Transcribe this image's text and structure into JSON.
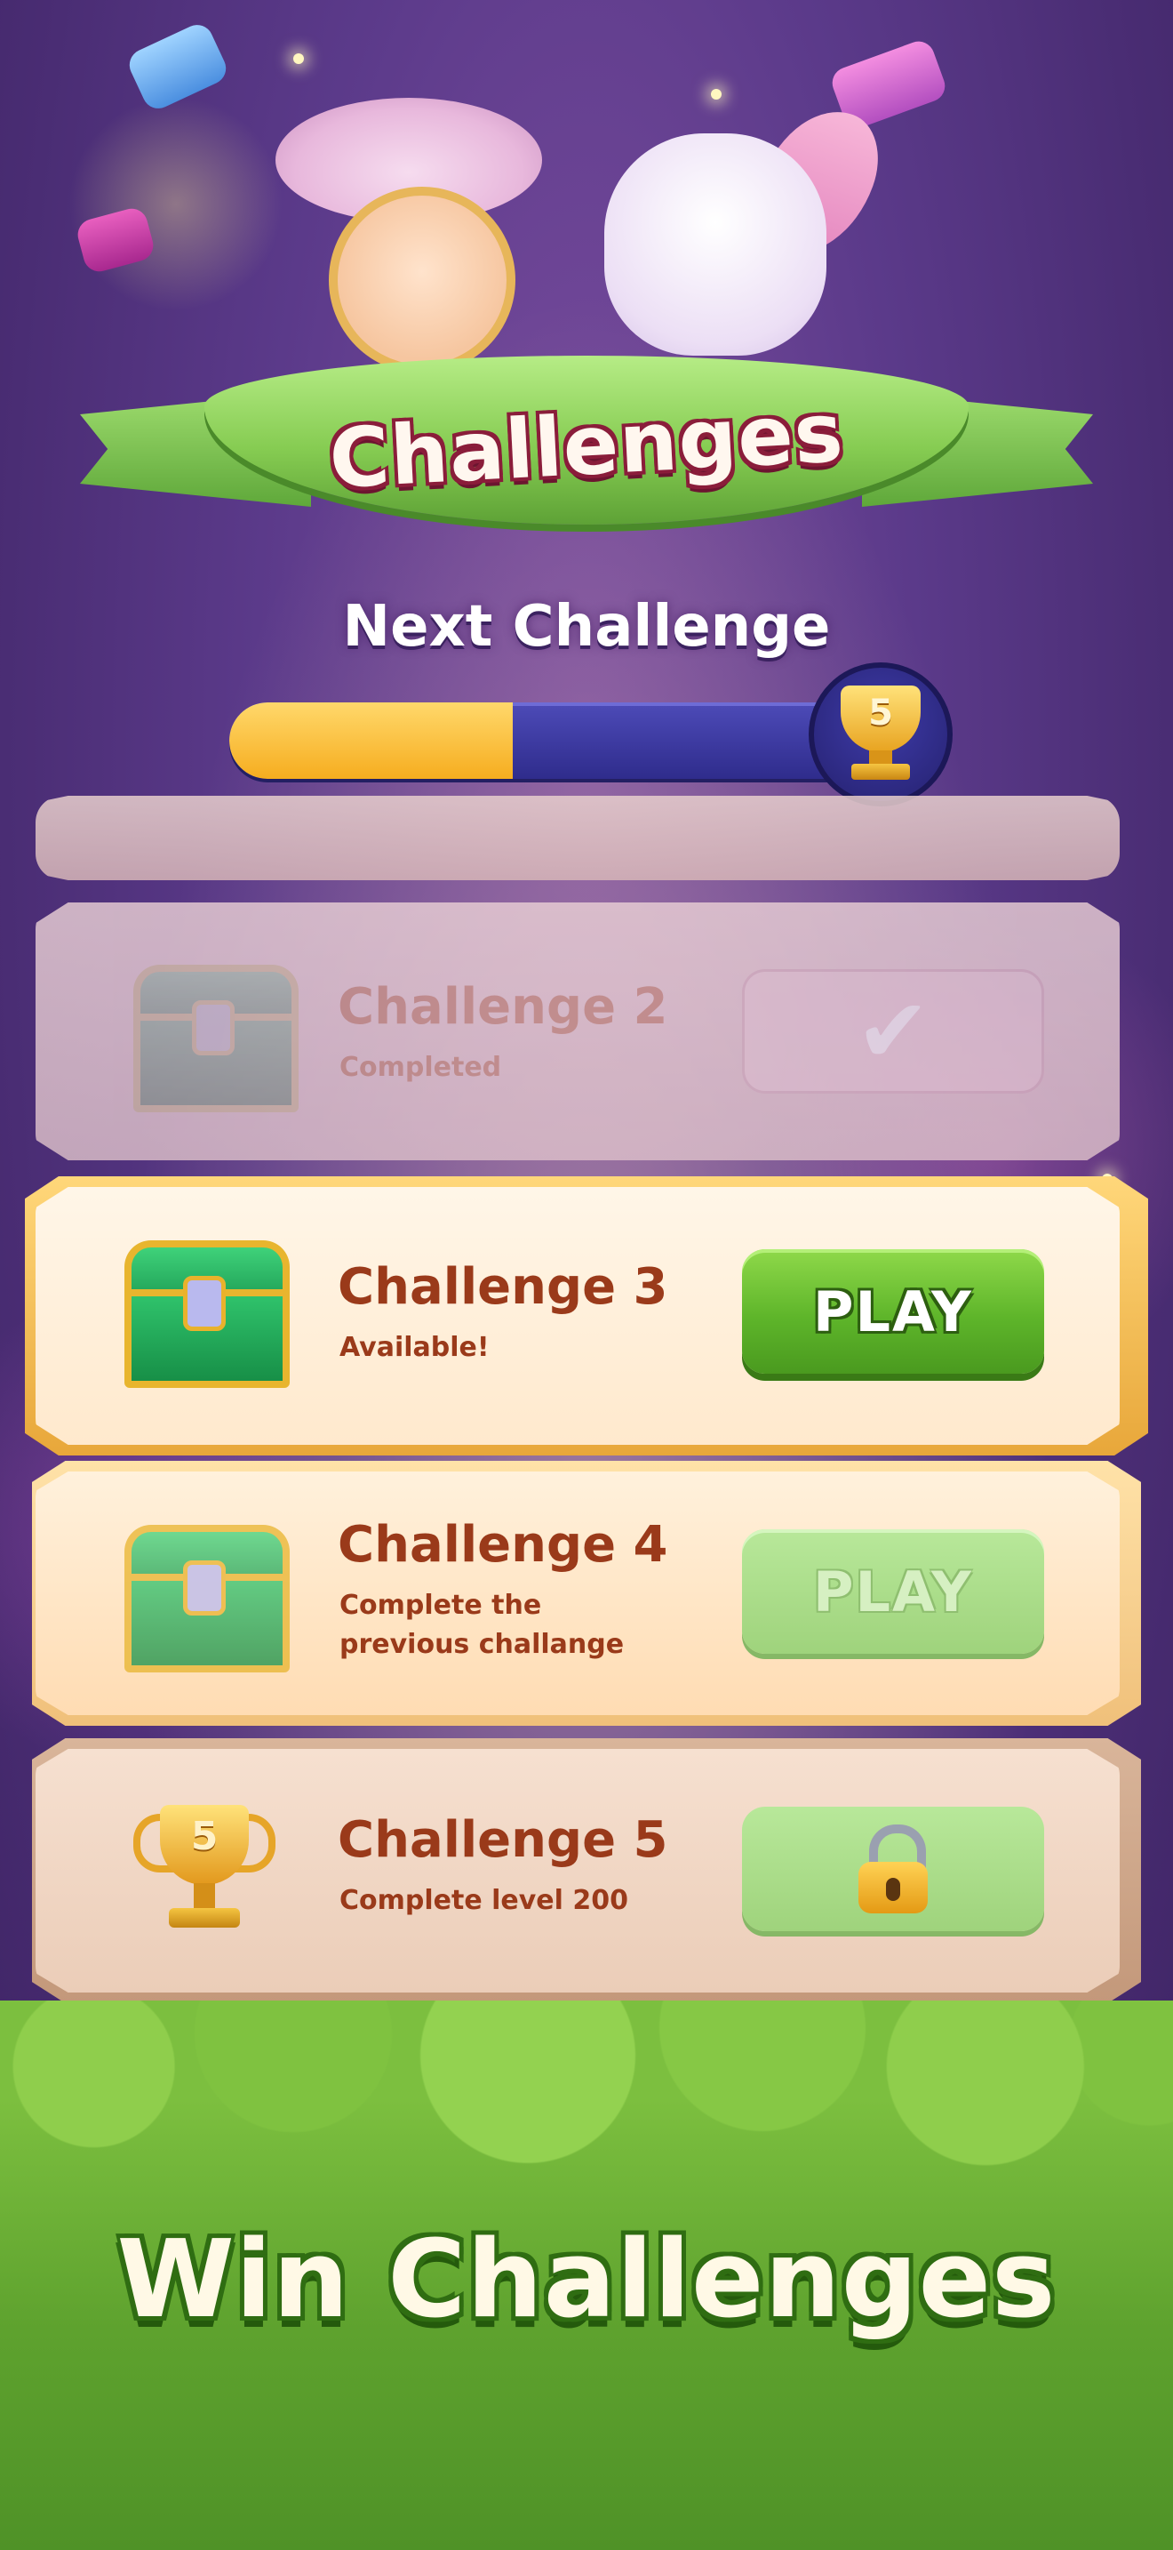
{
  "header": {
    "banner_title": "Challenges",
    "next_challenge_label": "Next Challenge",
    "progress_fraction": 0.42,
    "trophy_number": "5"
  },
  "challenges": [
    {
      "title": "Challenge 2",
      "subtitle": "Completed",
      "state": "completed",
      "reward_icon": "treasure-chest-icon",
      "action_icon": "checkmark-icon"
    },
    {
      "title": "Challenge 3",
      "subtitle": "Available!",
      "state": "available",
      "reward_icon": "treasure-chest-icon",
      "button_label": "PLAY"
    },
    {
      "title": "Challenge 4",
      "subtitle_line1": "Complete the",
      "subtitle_line2": "previous challange",
      "state": "disabled",
      "reward_icon": "treasure-chest-icon",
      "button_label": "PLAY"
    },
    {
      "title": "Challenge 5",
      "subtitle": "Complete level 200",
      "state": "locked",
      "reward_icon": "trophy-icon",
      "trophy_number": "5",
      "action_icon": "padlock-icon"
    }
  ],
  "footer": {
    "title": "Win Challenges"
  },
  "colors": {
    "title_text": "#9a3a1a",
    "play_green": "#5eb52a",
    "progress_fill": "#f6ad1f",
    "progress_track": "#2f2c8c",
    "banner_green": "#86cc52"
  }
}
